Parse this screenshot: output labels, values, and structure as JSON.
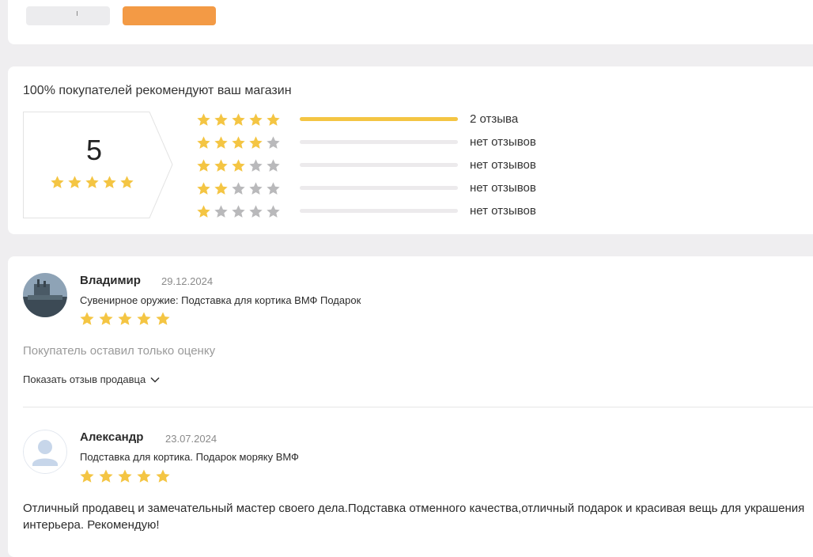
{
  "colors": {
    "star_filled": "#f4c543",
    "star_empty": "#b9b9bb",
    "bar_fill": "#f4c543",
    "bar_track": "#eceaec",
    "accent_button": "#f39a45"
  },
  "summary": {
    "recommend_text": "100% покупателей рекомендуют ваш магазин",
    "score": "5",
    "score_stars": 5
  },
  "distribution": [
    {
      "stars": 5,
      "label": "2 отзыва",
      "fill_fraction": 1.0
    },
    {
      "stars": 4,
      "label": "нет отзывов",
      "fill_fraction": 0
    },
    {
      "stars": 3,
      "label": "нет отзывов",
      "fill_fraction": 0
    },
    {
      "stars": 2,
      "label": "нет отзывов",
      "fill_fraction": 0
    },
    {
      "stars": 1,
      "label": "нет отзывов",
      "fill_fraction": 0
    }
  ],
  "reviews": [
    {
      "author": "Владимир",
      "date": "29.12.2024",
      "product": "Сувенирное оружие: Подставка для кортика ВМФ Подарок",
      "rating": 5,
      "avatar": "photo-avatar",
      "note": "Покупатель оставил только оценку",
      "seller_toggle": "Показать отзыв продавца",
      "seller_toggle_icon": "chevron-down-icon"
    },
    {
      "author": "Александр",
      "date": "23.07.2024",
      "product": "Подставка для кортика. Подарок моряку ВМФ",
      "rating": 5,
      "avatar": "default-user-avatar",
      "text": "Отличный продавец и замечательный мастер своего дела.Подставка отменного качества,отличный подарок и красивая вещь для украшения интерьера. Рекомендую!"
    }
  ]
}
